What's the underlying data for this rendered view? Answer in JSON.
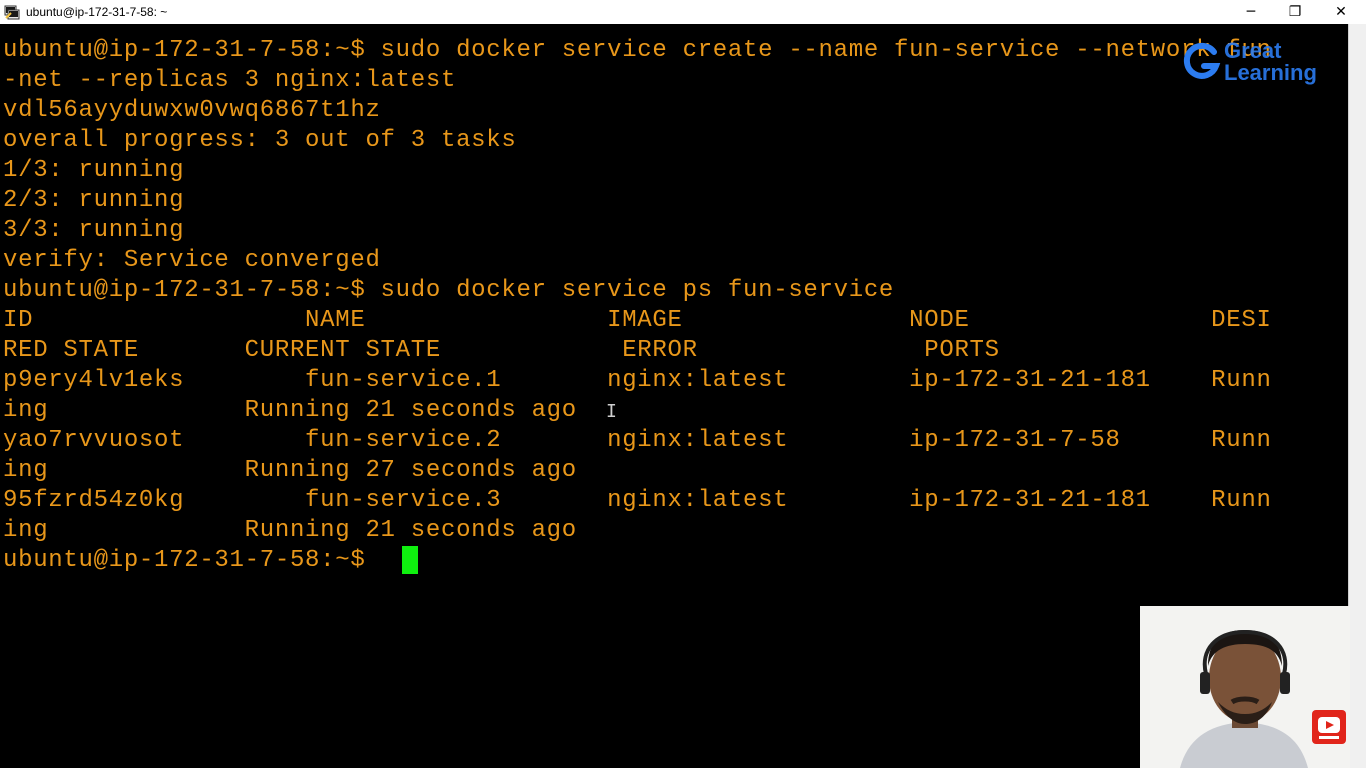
{
  "window": {
    "title": "ubuntu@ip-172-31-7-58: ~",
    "controls": {
      "minimize": "─",
      "restore": "❐",
      "close": "✕"
    }
  },
  "terminal": {
    "lines": [
      "ubuntu@ip-172-31-7-58:~$ sudo docker service create --name fun-service --network fun",
      "-net --replicas 3 nginx:latest",
      "vdl56ayyduwxw0vwq6867t1hz",
      "overall progress: 3 out of 3 tasks",
      "1/3: running",
      "2/3: running",
      "3/3: running",
      "verify: Service converged",
      "ubuntu@ip-172-31-7-58:~$ sudo docker service ps fun-service",
      "ID                  NAME                IMAGE               NODE                DESI",
      "RED STATE       CURRENT STATE            ERROR               PORTS",
      "p9ery4lv1eks        fun-service.1       nginx:latest        ip-172-31-21-181    Runn",
      "ing             Running 21 seconds ago",
      "yao7rvvuosot        fun-service.2       nginx:latest        ip-172-31-7-58      Runn",
      "ing             Running 27 seconds ago",
      "95fzrd54z0kg        fun-service.3       nginx:latest        ip-172-31-21-181    Runn",
      "ing             Running 21 seconds ago",
      "ubuntu@ip-172-31-7-58:~$ "
    ],
    "text_color": "#e8971a",
    "cursor_color": "#0ff00f"
  },
  "overlay": {
    "logo_line1": "Great",
    "logo_line2": "Learning",
    "logo_color": "#2c7cf0",
    "subscribe_icon": "youtube-subscribe-icon"
  }
}
